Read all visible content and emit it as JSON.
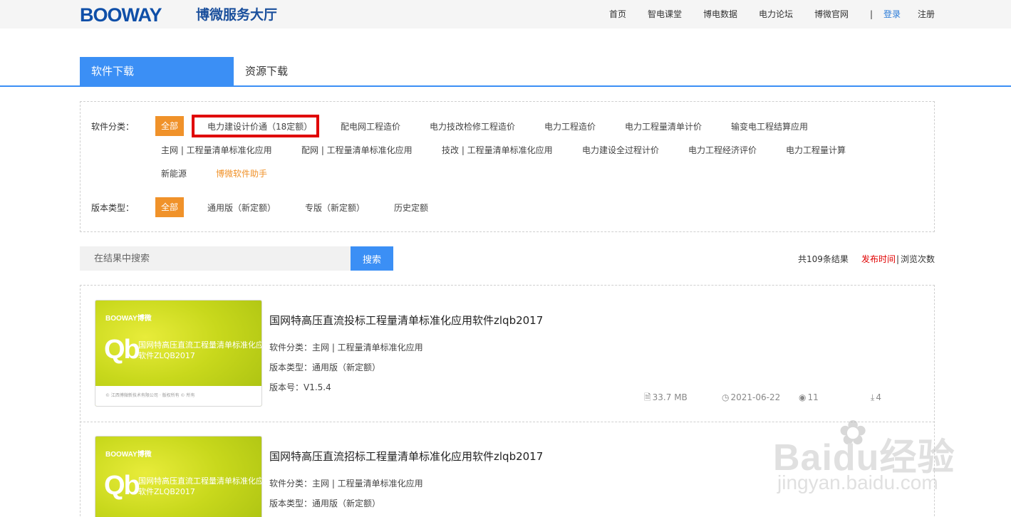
{
  "header": {
    "logo": "BOOWAY",
    "site_title": "博微服务大厅",
    "nav": [
      "首页",
      "智电课堂",
      "博电数据",
      "电力论坛",
      "博微官网"
    ],
    "divider": "|",
    "login": "登录",
    "register": "注册"
  },
  "tabs": [
    "软件下载",
    "资源下载"
  ],
  "filters": {
    "category_label": "软件分类：",
    "all_label": "全部",
    "category_row1": [
      "电力建设计价通（18定额）",
      "配电网工程造价",
      "电力技改检修工程造价",
      "电力工程造价",
      "电力工程量清单计价",
      "输变电工程结算应用"
    ],
    "category_row2": [
      "主网 | 工程量清单标准化应用",
      "配网 | 工程量清单标准化应用",
      "技改 | 工程量清单标准化应用",
      "电力建设全过程计价",
      "电力工程经济评价",
      "电力工程量计算"
    ],
    "category_row3": [
      "新能源",
      "博微软件助手"
    ],
    "version_label": "版本类型：",
    "version_items": [
      "通用版（新定额）",
      "专版（新定额）",
      "历史定额"
    ]
  },
  "search": {
    "placeholder": "在结果中搜索",
    "button": "搜索",
    "result_count": "共109条结果",
    "sort_time": "发布时间",
    "sort_sep": "|",
    "sort_views": "浏览次数"
  },
  "items": [
    {
      "thumb_brand": "BOOWAY博微",
      "thumb_logo": "Qb",
      "thumb_line1": "国网特高压直流工程量清单标准化应用",
      "thumb_line2": "软件ZLQB2017",
      "thumb_footer": "© 江西博微新技术有限公司 · 版权所有 © 所有",
      "title": "国网特高压直流投标工程量清单标准化应用软件zlqb2017",
      "category": "软件分类：主网 | 工程量清单标准化应用",
      "version_type": "版本类型：通用版（新定额）",
      "version_no": "版本号：V1.5.4",
      "size": "33.7 MB",
      "date": "2021-06-22",
      "views": "11",
      "downloads": "4"
    },
    {
      "thumb_brand": "BOOWAY博微",
      "thumb_logo": "Qb",
      "thumb_line1": "国网特高压直流工程量清单标准化应用",
      "thumb_line2": "软件ZLQB2017",
      "title": "国网特高压直流招标工程量清单标准化应用软件zlqb2017",
      "category": "软件分类：主网 | 工程量清单标准化应用",
      "version_type": "版本类型：通用版（新定额）"
    }
  ],
  "watermark": {
    "text": "Baidu经验",
    "url": "jingyan.baidu.com"
  },
  "colors": {
    "brand_blue": "#0f4fa8",
    "tab_blue": "#3b8ff5",
    "orange": "#f0922a",
    "highlight_red": "#e00000",
    "sort_red": "#e00000"
  }
}
